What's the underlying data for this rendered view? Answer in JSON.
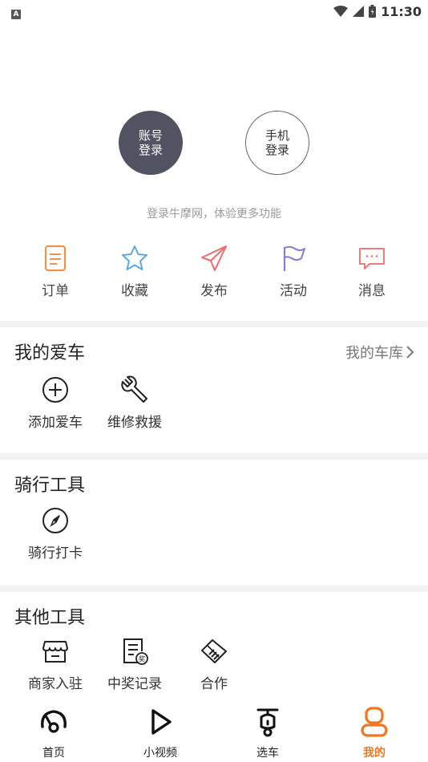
{
  "status_bar": {
    "time": "11:30",
    "notification_badge": "A"
  },
  "login": {
    "account_line1": "账号",
    "account_line2": "登录",
    "phone_line1": "手机",
    "phone_line2": "登录",
    "hint": "登录牛摩网，体验更多功能"
  },
  "quick_actions": [
    {
      "label": "订单",
      "icon": "order-icon",
      "color": "#f2924a"
    },
    {
      "label": "收藏",
      "icon": "star-icon",
      "color": "#5aa8e6"
    },
    {
      "label": "发布",
      "icon": "paper-plane-icon",
      "color": "#ee6b6b"
    },
    {
      "label": "活动",
      "icon": "flag-icon",
      "color": "#8b7bd8"
    },
    {
      "label": "消息",
      "icon": "message-icon",
      "color": "#ee7b7b"
    }
  ],
  "my_car": {
    "title": "我的爱车",
    "link": "我的车库",
    "tools": [
      {
        "label": "添加爱车",
        "icon": "add-circle-icon"
      },
      {
        "label": "维修救援",
        "icon": "wrench-icon"
      }
    ]
  },
  "riding_tools": {
    "title": "骑行工具",
    "tools": [
      {
        "label": "骑行打卡",
        "icon": "compass-icon"
      }
    ]
  },
  "other_tools": {
    "title": "其他工具",
    "tools": [
      {
        "label": "商家入驻",
        "icon": "store-icon"
      },
      {
        "label": "中奖记录",
        "icon": "prize-record-icon",
        "badge": "奖"
      },
      {
        "label": "合作",
        "icon": "handshake-icon"
      }
    ]
  },
  "tabbar": {
    "active_color": "#f2761e",
    "items": [
      {
        "label": "首页",
        "icon": "speedometer-icon"
      },
      {
        "label": "小视频",
        "icon": "play-icon"
      },
      {
        "label": "选车",
        "icon": "scooter-icon"
      },
      {
        "label": "我的",
        "icon": "profile-icon",
        "active": true
      }
    ]
  }
}
